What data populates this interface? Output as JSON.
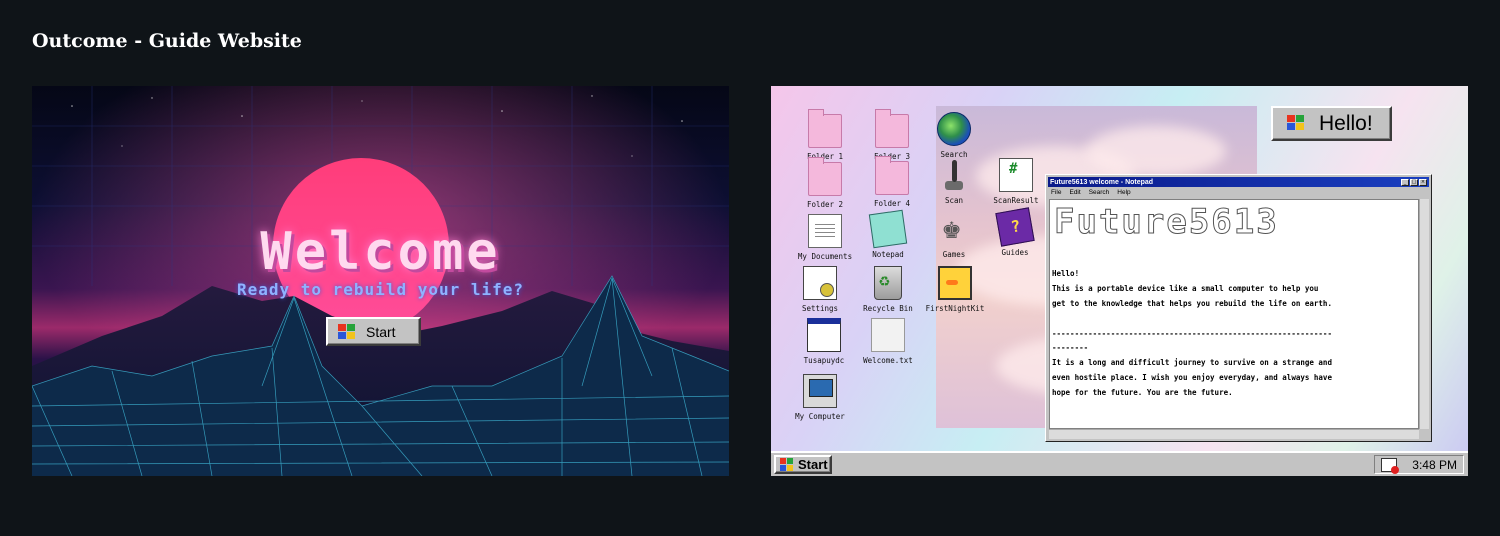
{
  "page": {
    "title": "Outcome - Guide Website"
  },
  "welcome": {
    "heading": "Welcome",
    "subtitle": "Ready to rebuild your life?",
    "start_label": "Start"
  },
  "desktop": {
    "icons": [
      {
        "label": "Folder 1",
        "icon": "folder-icon"
      },
      {
        "label": "Folder 3",
        "icon": "folder-icon"
      },
      {
        "label": "Search",
        "icon": "globe-search-icon"
      },
      {
        "label": "Folder 2",
        "icon": "folder-icon"
      },
      {
        "label": "Folder 4",
        "icon": "folder-icon"
      },
      {
        "label": "Scan",
        "icon": "joystick-icon"
      },
      {
        "label": "ScanResult",
        "icon": "document-icon"
      },
      {
        "label": "My Documents",
        "icon": "documents-icon"
      },
      {
        "label": "Notepad",
        "icon": "notepad-icon"
      },
      {
        "label": "Games",
        "icon": "chess-icon"
      },
      {
        "label": "Guides",
        "icon": "help-book-icon"
      },
      {
        "label": "Settings",
        "icon": "settings-icon"
      },
      {
        "label": "Recycle Bin",
        "icon": "recycle-bin-icon"
      },
      {
        "label": "FirstNightKit",
        "icon": "duck-icon"
      },
      {
        "label": "Tusapuydc",
        "icon": "window-icon"
      },
      {
        "label": "Welcome.txt",
        "icon": "text-file-icon"
      },
      {
        "label": "My Computer",
        "icon": "computer-icon"
      }
    ],
    "hello_label": "Hello!",
    "notepad": {
      "title": "Future5613 welcome - Notepad",
      "menu": [
        "File",
        "Edit",
        "Search",
        "Help"
      ],
      "logo": "Future5613",
      "lines": [
        "Hello!",
        "This is a portable device like a small computer to help you",
        "get to the knowledge that helps you rebuild the life on earth.",
        "",
        "--------------------------------------------------------------",
        "--------",
        "It is a long and difficult journey to survive on a strange and",
        "even hostile place. I wish you enjoy everyday, and always have",
        "hope for the future. You are the future."
      ]
    },
    "taskbar": {
      "start_label": "Start",
      "time": "3:48 PM"
    }
  }
}
